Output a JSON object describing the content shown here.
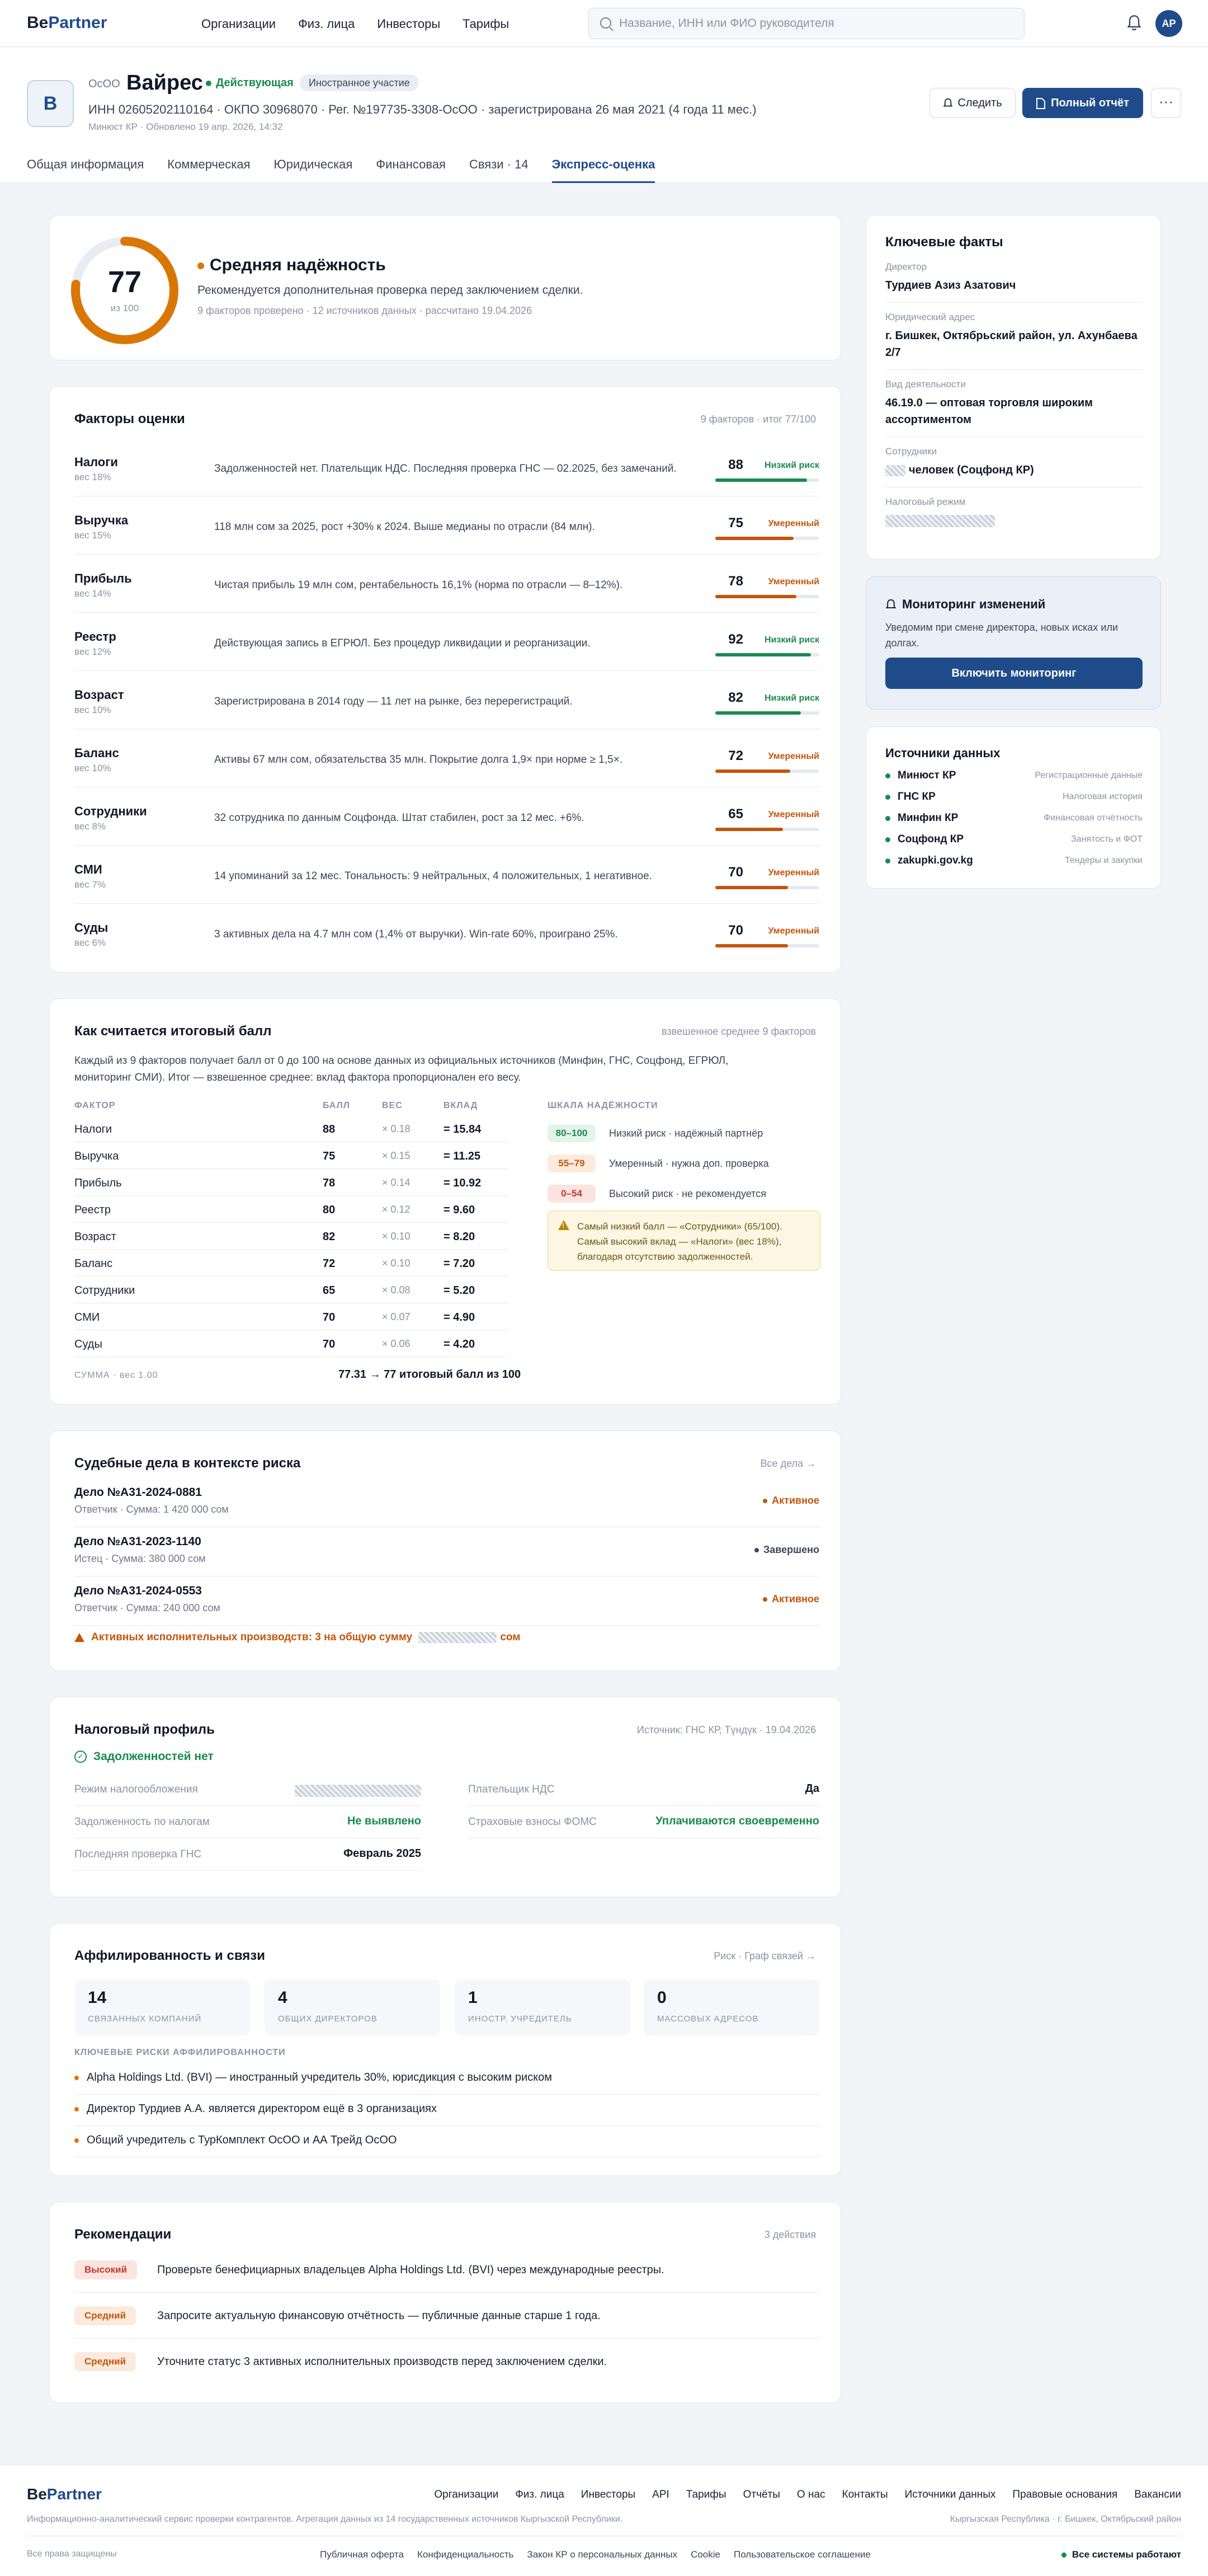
{
  "brand": {
    "logo_a": "Be",
    "logo_b": "Partner",
    "accent": "#1f4b8a"
  },
  "nav": [
    "Организации",
    "Физ. лица",
    "Инвесторы",
    "Тарифы"
  ],
  "search": {
    "placeholder": "Название, ИНН или ФИО руководителя",
    "value": ""
  },
  "user": {
    "initials": "АР"
  },
  "company": {
    "logo_letter": "В",
    "form": "ОсОО",
    "name": "Вайрес",
    "status": "Действующая",
    "tag": "Иностранное участие",
    "ids": "ИНН 02605202110164 · ОКПО 30968070 · Рег. №197735-3308-ОсОО · зарегистрирована 26 мая 2021 (4 года 11 мес.)",
    "updated": "Минюст КР · Обновлено 19 апр. 2026, 14:32",
    "follow_label": "Следить",
    "report_label": "Полный отчёт",
    "more_label": "···"
  },
  "tabs": [
    "Общая информация",
    "Коммерческая",
    "Юридическая",
    "Финансовая",
    "Связи · 14",
    "Экспресс-оценка"
  ],
  "score": {
    "value": 77,
    "max_label": "из 100",
    "label": "Средняя надёжность",
    "description": "Рекомендуется дополнительная проверка перед заключением сделки.",
    "meta": "9 факторов проверено · 12 источников данных · рассчитано 19.04.2026"
  },
  "factors": {
    "title": "Факторы оценки",
    "meta": "9 факторов · итог 77/100",
    "items": [
      {
        "name": "Налоги",
        "weight": "вес 18%",
        "desc": "Задолженностей нет. Плательщик НДС. Последняя проверка ГНС — 02.2025, без замечаний.",
        "score": 88,
        "risk": "Низкий риск",
        "level": "low"
      },
      {
        "name": "Выручка",
        "weight": "вес 15%",
        "desc": "118 млн сом за 2025, рост +30% к 2024. Выше медианы по отрасли (84 млн).",
        "score": 75,
        "risk": "Умеренный",
        "level": "mid"
      },
      {
        "name": "Прибыль",
        "weight": "вес 14%",
        "desc": "Чистая прибыль 19 млн сом, рентабельность 16,1% (норма по отрасли — 8–12%).",
        "score": 78,
        "risk": "Умеренный",
        "level": "mid"
      },
      {
        "name": "Реестр",
        "weight": "вес 12%",
        "desc": "Действующая запись в ЕГРЮЛ. Без процедур ликвидации и реорганизации.",
        "score": 92,
        "risk": "Низкий риск",
        "level": "low"
      },
      {
        "name": "Возраст",
        "weight": "вес 10%",
        "desc": "Зарегистрирована в 2014 году — 11 лет на рынке, без перерегистраций.",
        "score": 82,
        "risk": "Низкий риск",
        "level": "low"
      },
      {
        "name": "Баланс",
        "weight": "вес 10%",
        "desc": "Активы 67 млн сом, обязательства 35 млн. Покрытие долга 1,9× при норме ≥ 1,5×.",
        "score": 72,
        "risk": "Умеренный",
        "level": "mid"
      },
      {
        "name": "Сотрудники",
        "weight": "вес 8%",
        "desc": "32 сотрудника по данным Соцфонда. Штат стабилен, рост за 12 мес. +6%.",
        "score": 65,
        "risk": "Умеренный",
        "level": "mid"
      },
      {
        "name": "СМИ",
        "weight": "вес 7%",
        "desc": "14 упоминаний за 12 мес. Тональность: 9 нейтральных, 4 положительных, 1 негативное.",
        "score": 70,
        "risk": "Умеренный",
        "level": "mid"
      },
      {
        "name": "Суды",
        "weight": "вес 6%",
        "desc": "3 активных дела на 4.7 млн сом (1,4% от выручки). Win-rate 60%, проиграно 25%.",
        "score": 70,
        "risk": "Умеренный",
        "level": "mid"
      }
    ]
  },
  "calc": {
    "title": "Как считается итоговый балл",
    "meta": "взвешенное среднее 9 факторов",
    "description_1": "Каждый из 9 факторов получает балл от 0 до 100 на основе данных из официальных источников (Минфин, ГНС, Соцфонд, ЕГРЮЛ,",
    "description_2": "мониторинг СМИ). Итог — взвешенное среднее: вклад фактора пропорционален его весу.",
    "headers": [
      "ФАКТОР",
      "БАЛЛ",
      "ВЕС",
      "ВКЛАД"
    ],
    "rows": [
      {
        "f": "Налоги",
        "s": "88",
        "w": "× 0.18",
        "c": "= 15.84"
      },
      {
        "f": "Выручка",
        "s": "75",
        "w": "× 0.15",
        "c": "= 11.25"
      },
      {
        "f": "Прибыль",
        "s": "78",
        "w": "× 0.14",
        "c": "= 10.92"
      },
      {
        "f": "Реестр",
        "s": "80",
        "w": "× 0.12",
        "c": "= 9.60"
      },
      {
        "f": "Возраст",
        "s": "82",
        "w": "× 0.10",
        "c": "= 8.20"
      },
      {
        "f": "Баланс",
        "s": "72",
        "w": "× 0.10",
        "c": "= 7.20"
      },
      {
        "f": "Сотрудники",
        "s": "65",
        "w": "× 0.08",
        "c": "= 5.20"
      },
      {
        "f": "СМИ",
        "s": "70",
        "w": "× 0.07",
        "c": "= 4.90"
      },
      {
        "f": "Суды",
        "s": "70",
        "w": "× 0.06",
        "c": "= 4.20"
      }
    ],
    "sum_label": "СУММА · вес 1.00",
    "sum_value": "77.31 → 77 итоговый балл из 100",
    "scale_title": "ШКАЛА НАДЁЖНОСТИ",
    "scale": [
      {
        "range": "80–100",
        "text": "Низкий риск · надёжный партнёр"
      },
      {
        "range": "55–79",
        "text": "Умеренный · нужна доп. проверка"
      },
      {
        "range": "0–54",
        "text": "Высокий риск · не рекомендуется"
      }
    ],
    "note_1": "Самый низкий балл — «Сотрудники» (65/100).",
    "note_2": "Самый высокий вклад — «Налоги» (вес 18%),",
    "note_3": "благодаря отсутствию задолженностей."
  },
  "court": {
    "title": "Судебные дела в контексте риска",
    "link": "Все дела →",
    "cases": [
      {
        "num": "Дело №А31-2024-0881",
        "sub": "Ответчик · Сумма: 1 420 000 сом",
        "status": "Активное",
        "active": true
      },
      {
        "num": "Дело №А31-2023-1140",
        "sub": "Истец · Сумма: 380 000 сом",
        "status": "Завершено",
        "active": false
      },
      {
        "num": "Дело №А31-2024-0553",
        "sub": "Ответчик · Сумма: 240 000 сом",
        "status": "Активное",
        "active": true
      }
    ],
    "warning_a": "Активных исполнительных производств: 3 на общую сумму",
    "warning_b": "сом"
  },
  "tax": {
    "title": "Налоговый профиль",
    "meta": "Источник: ГНС КР, Түндүк · 19.04.2026",
    "status": "Задолженностей нет",
    "left": [
      {
        "k": "Режим налогообложения",
        "v": ""
      },
      {
        "k": "Задолженность по налогам",
        "v": "Не выявлено"
      },
      {
        "k": "Последняя проверка ГНС",
        "v": "Февраль 2025"
      }
    ],
    "right": [
      {
        "k": "Плательщик НДС",
        "v": "Да"
      },
      {
        "k": "Страховые взносы ФОМС",
        "v": "Уплачиваются своевременно"
      }
    ]
  },
  "affil": {
    "title": "Аффилированность и связи",
    "link": "Риск · Граф связей →",
    "stats": [
      {
        "n": "14",
        "l": "СВЯЗАННЫХ КОМПАНИЙ"
      },
      {
        "n": "4",
        "l": "ОБЩИХ ДИРЕКТОРОВ"
      },
      {
        "n": "1",
        "l": "ИНОСТР. УЧРЕДИТЕЛЬ"
      },
      {
        "n": "0",
        "l": "МАССОВЫХ АДРЕСОВ"
      }
    ],
    "risks_title": "КЛЮЧЕВЫЕ РИСКИ АФФИЛИРОВАННОСТИ",
    "risks": [
      "Alpha Holdings Ltd. (BVI) — иностранный учредитель 30%, юрисдикция с высоким риском",
      "Директор Турдиев А.А. является директором ещё в 3 организациях",
      "Общий учредитель с ТурКомплект ОсОО и АА Трейд ОсОО"
    ]
  },
  "recs": {
    "title": "Рекомендации",
    "meta": "3 действия",
    "items": [
      {
        "p": "Высокий",
        "t": "Проверьте бенефициарных владельцев Alpha Holdings Ltd. (BVI) через международные реестры."
      },
      {
        "p": "Средний",
        "t": "Запросите актуальную финансовую отчётность — публичные данные старше 1 года."
      },
      {
        "p": "Средний",
        "t": "Уточните статус 3 активных исполнительных производств перед заключением сделки."
      }
    ]
  },
  "facts": {
    "title": "Ключевые факты",
    "items": [
      {
        "l": "Директор",
        "v": "Турдиев Азиз Азатович"
      },
      {
        "l": "Юридический адрес",
        "v": "г. Бишкек, Октябрьский район, ул. Ахунбаева 2/7"
      },
      {
        "l": "Вид деятельности",
        "v": "46.19.0 — оптовая торговля широким ассортиментом"
      },
      {
        "l": "Сотрудники",
        "v": "человек (Соцфонд КР)"
      },
      {
        "l": "Налоговый режим",
        "v": ""
      }
    ]
  },
  "monitor": {
    "title": "Мониторинг изменений",
    "desc_1": "Уведомим при смене директора, новых исках или",
    "desc_2": "долгах.",
    "button": "Включить мониторинг"
  },
  "sources": {
    "title": "Источники данных",
    "items": [
      {
        "n": "Минюст КР",
        "d": "Регистрационные данные"
      },
      {
        "n": "ГНС КР",
        "d": "Налоговая история"
      },
      {
        "n": "Минфин КР",
        "d": "Финансовая отчётность"
      },
      {
        "n": "Соцфонд КР",
        "d": "Занятость и ФОТ"
      },
      {
        "n": "zakupki.gov.kg",
        "d": "Тендеры и закупки"
      }
    ]
  },
  "footer": {
    "links": [
      "Организации",
      "Физ. лица",
      "Инвесторы",
      "API",
      "Тарифы",
      "Отчёты",
      "О нас",
      "Контакты",
      "Источники данных",
      "Правовые основания",
      "Вакансии"
    ],
    "desc": "Информационно-аналитический сервис проверки контрагентов. Агрегация данных из 14 государственных источников Кыргызской Республики.",
    "address": "Кыргызская Республика · г. Бишкек, Октябрьский район",
    "copy": "Все права защищены",
    "legal": [
      "Публичная оферта",
      "Конфиденциальность",
      "Закон КР о персональных данных",
      "Cookie",
      "Пользовательское соглашение"
    ],
    "system": "Все системы работают"
  },
  "colors": {
    "low": "#1a8a52",
    "mid": "#c2560c",
    "high": "#c0392b",
    "gauge": "#d97706"
  }
}
